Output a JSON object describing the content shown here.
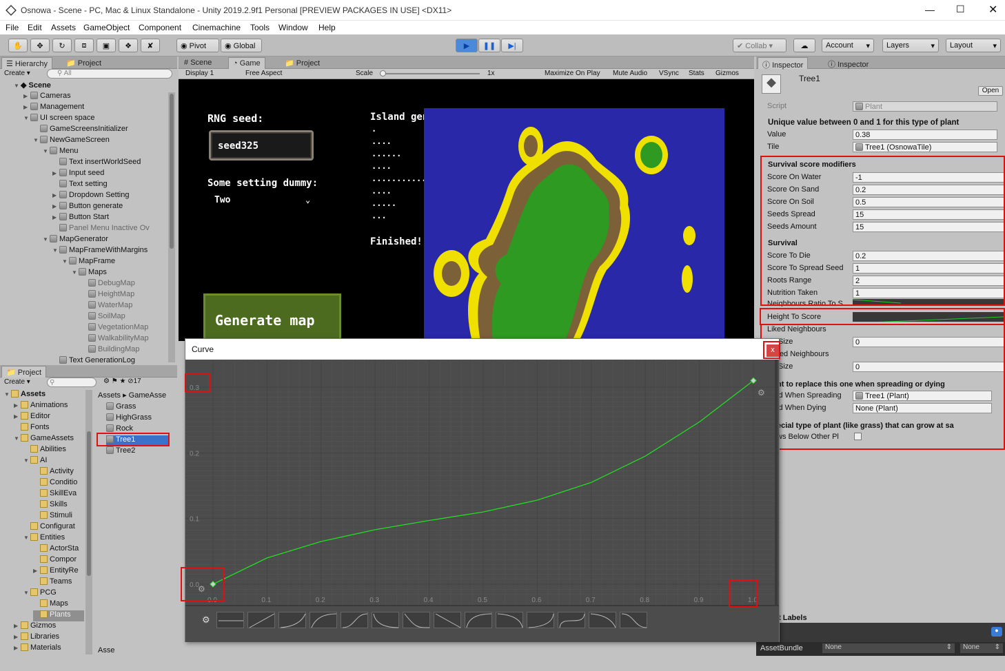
{
  "window": {
    "title": "Osnowa - Scene - PC, Mac & Linux Standalone - Unity 2019.2.9f1 Personal [PREVIEW PACKAGES IN USE] <DX11>"
  },
  "menu": [
    "File",
    "Edit",
    "Assets",
    "GameObject",
    "Component",
    "Cinemachine",
    "Tools",
    "Window",
    "Help"
  ],
  "toolbar": {
    "pivot": "Pivot",
    "global": "Global",
    "collab": "Collab",
    "account": "Account",
    "layers": "Layers",
    "layout": "Layout"
  },
  "hierarchy": {
    "tab": "Hierarchy",
    "tab2": "Project",
    "create": "Create",
    "search_placeholder": "All",
    "scene": "Scene",
    "items": [
      "Cameras",
      "Management",
      "UI screen space",
      "GameScreensInitializer",
      "NewGameScreen",
      "Menu",
      "Text insertWorldSeed",
      "Input seed",
      "Text setting",
      "Dropdown Setting",
      "Button generate",
      "Button Start",
      "Panel Menu Inactive Ov",
      "MapGenerator",
      "MapFrameWithMargins",
      "MapFrame",
      "Maps",
      "DebugMap",
      "HeightMap",
      "WaterMap",
      "SoilMap",
      "VegetationMap",
      "WalkabilityMap",
      "BuildingMap",
      "Text GenerationLog"
    ]
  },
  "project": {
    "tab": "Project",
    "create": "Create",
    "count": "17",
    "breadcrumb_root": "Assets",
    "breadcrumb_child": "GameAsse",
    "tree": [
      "Assets",
      "Animations",
      "Editor",
      "Fonts",
      "GameAssets",
      "Abilities",
      "AI",
      "Activity",
      "Conditio",
      "SkillEva",
      "Skills",
      "Stimuli",
      "Configurat",
      "Entities",
      "ActorSta",
      "Compor",
      "EntityRe",
      "Teams",
      "PCG",
      "Maps",
      "Plants",
      "Gizmos",
      "Libraries",
      "Materials"
    ],
    "files": [
      "Grass",
      "HighGrass",
      "Rock",
      "Tree1",
      "Tree2"
    ],
    "footer": "Asse"
  },
  "sceneTabs": {
    "scene": "Scene",
    "game": "Game",
    "project": "Project"
  },
  "gameBar": {
    "display": "Display 1",
    "aspect": "Free Aspect",
    "scale": "Scale",
    "scale_val": "1x",
    "max": "Maximize On Play",
    "mute": "Mute Audio",
    "vsync": "VSync",
    "stats": "Stats",
    "gizmos": "Gizmos"
  },
  "game": {
    "rng_label": "RNG seed:",
    "seed": "seed325",
    "setting_label": "Some setting dummy:",
    "setting_value": "Two",
    "island_label": "Island generation:",
    "log": [
      ".",
      "....",
      "......",
      "....",
      "...............",
      "....",
      ".....",
      "..."
    ],
    "finished": "Finished!",
    "generate": "Generate map"
  },
  "inspector": {
    "tab": "Inspector",
    "tab2": "Inspector",
    "object": "Tree1",
    "open": "Open",
    "script_label": "Script",
    "script_value": "Plant",
    "header1": "Unique value between 0 and 1 for this type of plant",
    "value_label": "Value",
    "value": "0.38",
    "tile_label": "Tile",
    "tile_value": "Tree1 (OsnowaTile)",
    "header2": "Survival score modifiers",
    "fields1": [
      [
        "Score On Water",
        "-1"
      ],
      [
        "Score On Sand",
        "0.2"
      ],
      [
        "Score On Soil",
        "0.5"
      ],
      [
        "Seeds Spread",
        "15"
      ],
      [
        "Seeds Amount",
        "15"
      ]
    ],
    "header3": "Survival",
    "fields2": [
      [
        "Score To Die",
        "0.2"
      ],
      [
        "Score To Spread Seed",
        "1"
      ],
      [
        "Roots Range",
        "2"
      ],
      [
        "Nutrition Taken",
        "1"
      ]
    ],
    "ratio_label": "Neighbours Ratio To S",
    "height_label": "Height To Score",
    "liked": "Liked Neighbours",
    "size": "Size",
    "size_val": "0",
    "disliked": "iked Neighbours",
    "size2": "Size",
    "size2_val": "0",
    "header4": "nt to replace this one when spreading or dying",
    "spread_label": "ld When Spreading",
    "spread_value": "Tree1 (Plant)",
    "dying_label": "ld When Dying",
    "dying_value": "None (Plant)",
    "header5": "ecial type of plant (like grass) that can grow at sa",
    "below_label": "ws Below Other Pl",
    "labels": "t Labels",
    "assetbundle": "AssetBundle",
    "none1": "None",
    "none2": "None"
  },
  "curve": {
    "title": "Curve",
    "close": "x",
    "y_ticks": [
      "0.3",
      "0.2",
      "0.1",
      "0.0"
    ],
    "x_ticks": [
      "0.0",
      "0.1",
      "0.2",
      "0.3",
      "0.4",
      "0.5",
      "0.6",
      "0.7",
      "0.8",
      "0.9",
      "1.0"
    ],
    "points": [
      [
        0.0,
        0.0
      ],
      [
        0.1,
        0.04
      ],
      [
        0.2,
        0.065
      ],
      [
        0.3,
        0.083
      ],
      [
        0.4,
        0.097
      ],
      [
        0.5,
        0.11
      ],
      [
        0.6,
        0.128
      ],
      [
        0.7,
        0.155
      ],
      [
        0.8,
        0.195
      ],
      [
        0.9,
        0.247
      ],
      [
        1.0,
        0.31
      ]
    ],
    "line_color": "#22dd22"
  }
}
